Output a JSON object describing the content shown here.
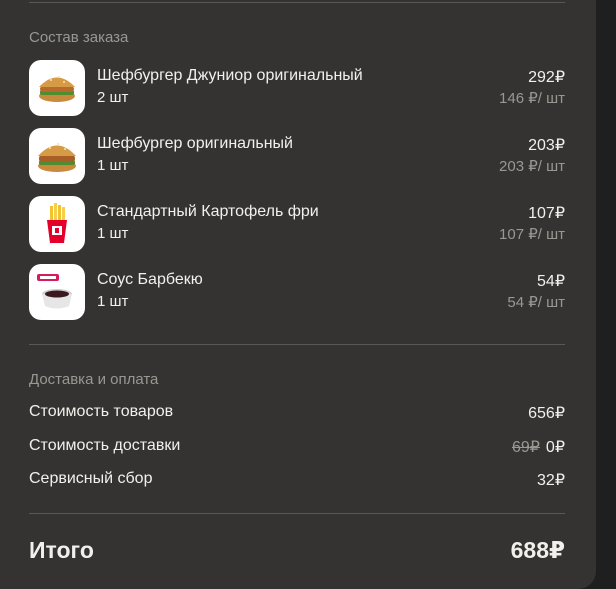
{
  "order": {
    "title": "Состав заказа",
    "items": [
      {
        "name": "Шефбургер Джуниор оригинальный",
        "qty": "2 шт",
        "price": "292₽",
        "unit_price": "146 ₽/ шт",
        "icon": "burger-image"
      },
      {
        "name": "Шефбургер оригинальный",
        "qty": "1 шт",
        "price": "203₽",
        "unit_price": "203 ₽/ шт",
        "icon": "burger-image"
      },
      {
        "name": "Стандартный Картофель фри",
        "qty": "1 шт",
        "price": "107₽",
        "unit_price": "107 ₽/ шт",
        "icon": "fries-image"
      },
      {
        "name": "Соус Барбекю",
        "qty": "1 шт",
        "price": "54₽",
        "unit_price": "54 ₽/ шт",
        "icon": "sauce-image"
      }
    ]
  },
  "delivery": {
    "title": "Доставка и оплата",
    "rows": [
      {
        "label": "Стоимость товаров",
        "value": "656₽"
      },
      {
        "label": "Стоимость доставки",
        "old_value": "69₽",
        "value": "0₽"
      },
      {
        "label": "Сервисный сбор",
        "value": "32₽"
      }
    ]
  },
  "total": {
    "label": "Итого",
    "value": "688₽"
  },
  "colors": {
    "panel": "#353331",
    "text": "#f2f0ec",
    "muted": "#9a9793",
    "brand_red": "#e4002b"
  }
}
